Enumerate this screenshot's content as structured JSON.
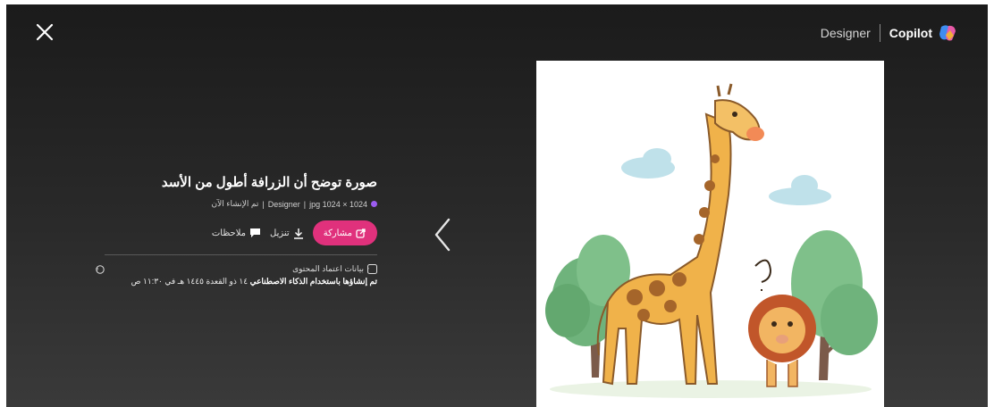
{
  "header": {
    "designer_label": "Designer",
    "copilot_label": "Copilot"
  },
  "image_info": {
    "title": "صورة توضح أن الزرافة أطول من الأسد",
    "meta": {
      "format": "1024 × 1024 jpg",
      "app": "Designer",
      "created": "تم الإنشاء الآن",
      "separator": "|"
    },
    "actions": {
      "share": "مشاركة",
      "download": "تنزيل",
      "notes": "ملاحظات"
    },
    "credentials": {
      "label": "بيانات اعتماد المحتوى",
      "detail_bold": "تم إنشاؤها باستخدام الذكاء الاصطناعي",
      "detail_rest": " ١٤ ذو القعدة ١٤٤٥ هـ في ١١:٣٠ ص"
    }
  },
  "colors": {
    "accent_share": "#e0317c",
    "background": "#222222"
  },
  "icons": [
    "close-icon",
    "copilot-logo-icon",
    "designer-app-icon",
    "share-icon",
    "download-icon",
    "comment-icon",
    "content-credentials-icon",
    "help-icon",
    "chevron-left-icon"
  ]
}
